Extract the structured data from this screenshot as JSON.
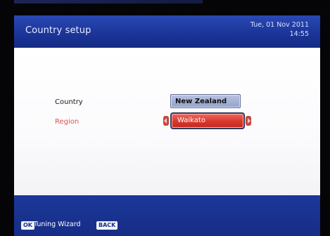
{
  "header": {
    "title": "Country setup",
    "date": "Tue, 01 Nov 2011",
    "time": "14:55"
  },
  "form": {
    "country_label": "Country",
    "country_value": "New Zealand",
    "region_label": "Region",
    "region_value": "Waikato"
  },
  "footer": {
    "ok_key": "OK",
    "ok_action": "Tuning Wizard",
    "back_key": "BACK"
  },
  "colors": {
    "header_blue": "#1b3599",
    "highlight_red": "#d9362c",
    "country_field": "#93a1cb"
  },
  "icons": [
    "left-arrow-icon",
    "right-arrow-icon"
  ]
}
